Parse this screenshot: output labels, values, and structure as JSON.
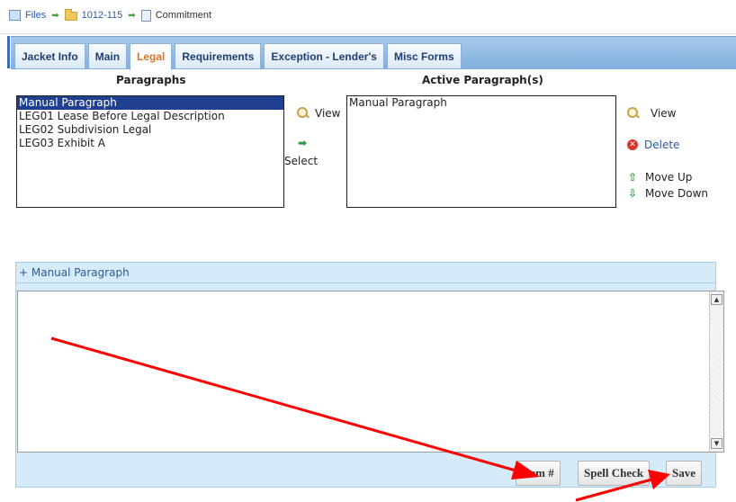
{
  "breadcrumb": {
    "items": [
      {
        "label": "Files",
        "icon": "files-icon"
      },
      {
        "label": "1012-115",
        "icon": "folder-icon"
      },
      {
        "label": "Commitment",
        "icon": "document-icon"
      }
    ]
  },
  "tabs": [
    {
      "label": "Jacket Info",
      "active": false
    },
    {
      "label": "Main",
      "active": false
    },
    {
      "label": "Legal",
      "active": true
    },
    {
      "label": "Requirements",
      "active": false
    },
    {
      "label": "Exception - Lender's",
      "active": false
    },
    {
      "label": "Misc Forms",
      "active": false
    }
  ],
  "paragraphs": {
    "heading": "Paragraphs",
    "options": [
      "Manual Paragraph",
      "LEG01 Lease Before Legal Description",
      "LEG02 Subdivision Legal",
      "LEG03 Exhibit A"
    ],
    "selected_index": 0,
    "view_label": "View",
    "select_label": "Select"
  },
  "active_paragraphs": {
    "heading": "Active Paragraph(s)",
    "options": [
      "Manual Paragraph"
    ],
    "view_label": "View",
    "delete_label": "Delete",
    "move_up_label": "Move Up",
    "move_down_label": "Move Down"
  },
  "manual_panel": {
    "title": "+ Manual Paragraph",
    "editor_value": ""
  },
  "buttons": {
    "item_number": "Item #",
    "spell_check": "Spell Check",
    "save": "Save"
  },
  "colors": {
    "tab_active_text": "#e0742a",
    "annotation_arrow": "#ff0000",
    "selected_row_bg": "#1f3f8f"
  }
}
